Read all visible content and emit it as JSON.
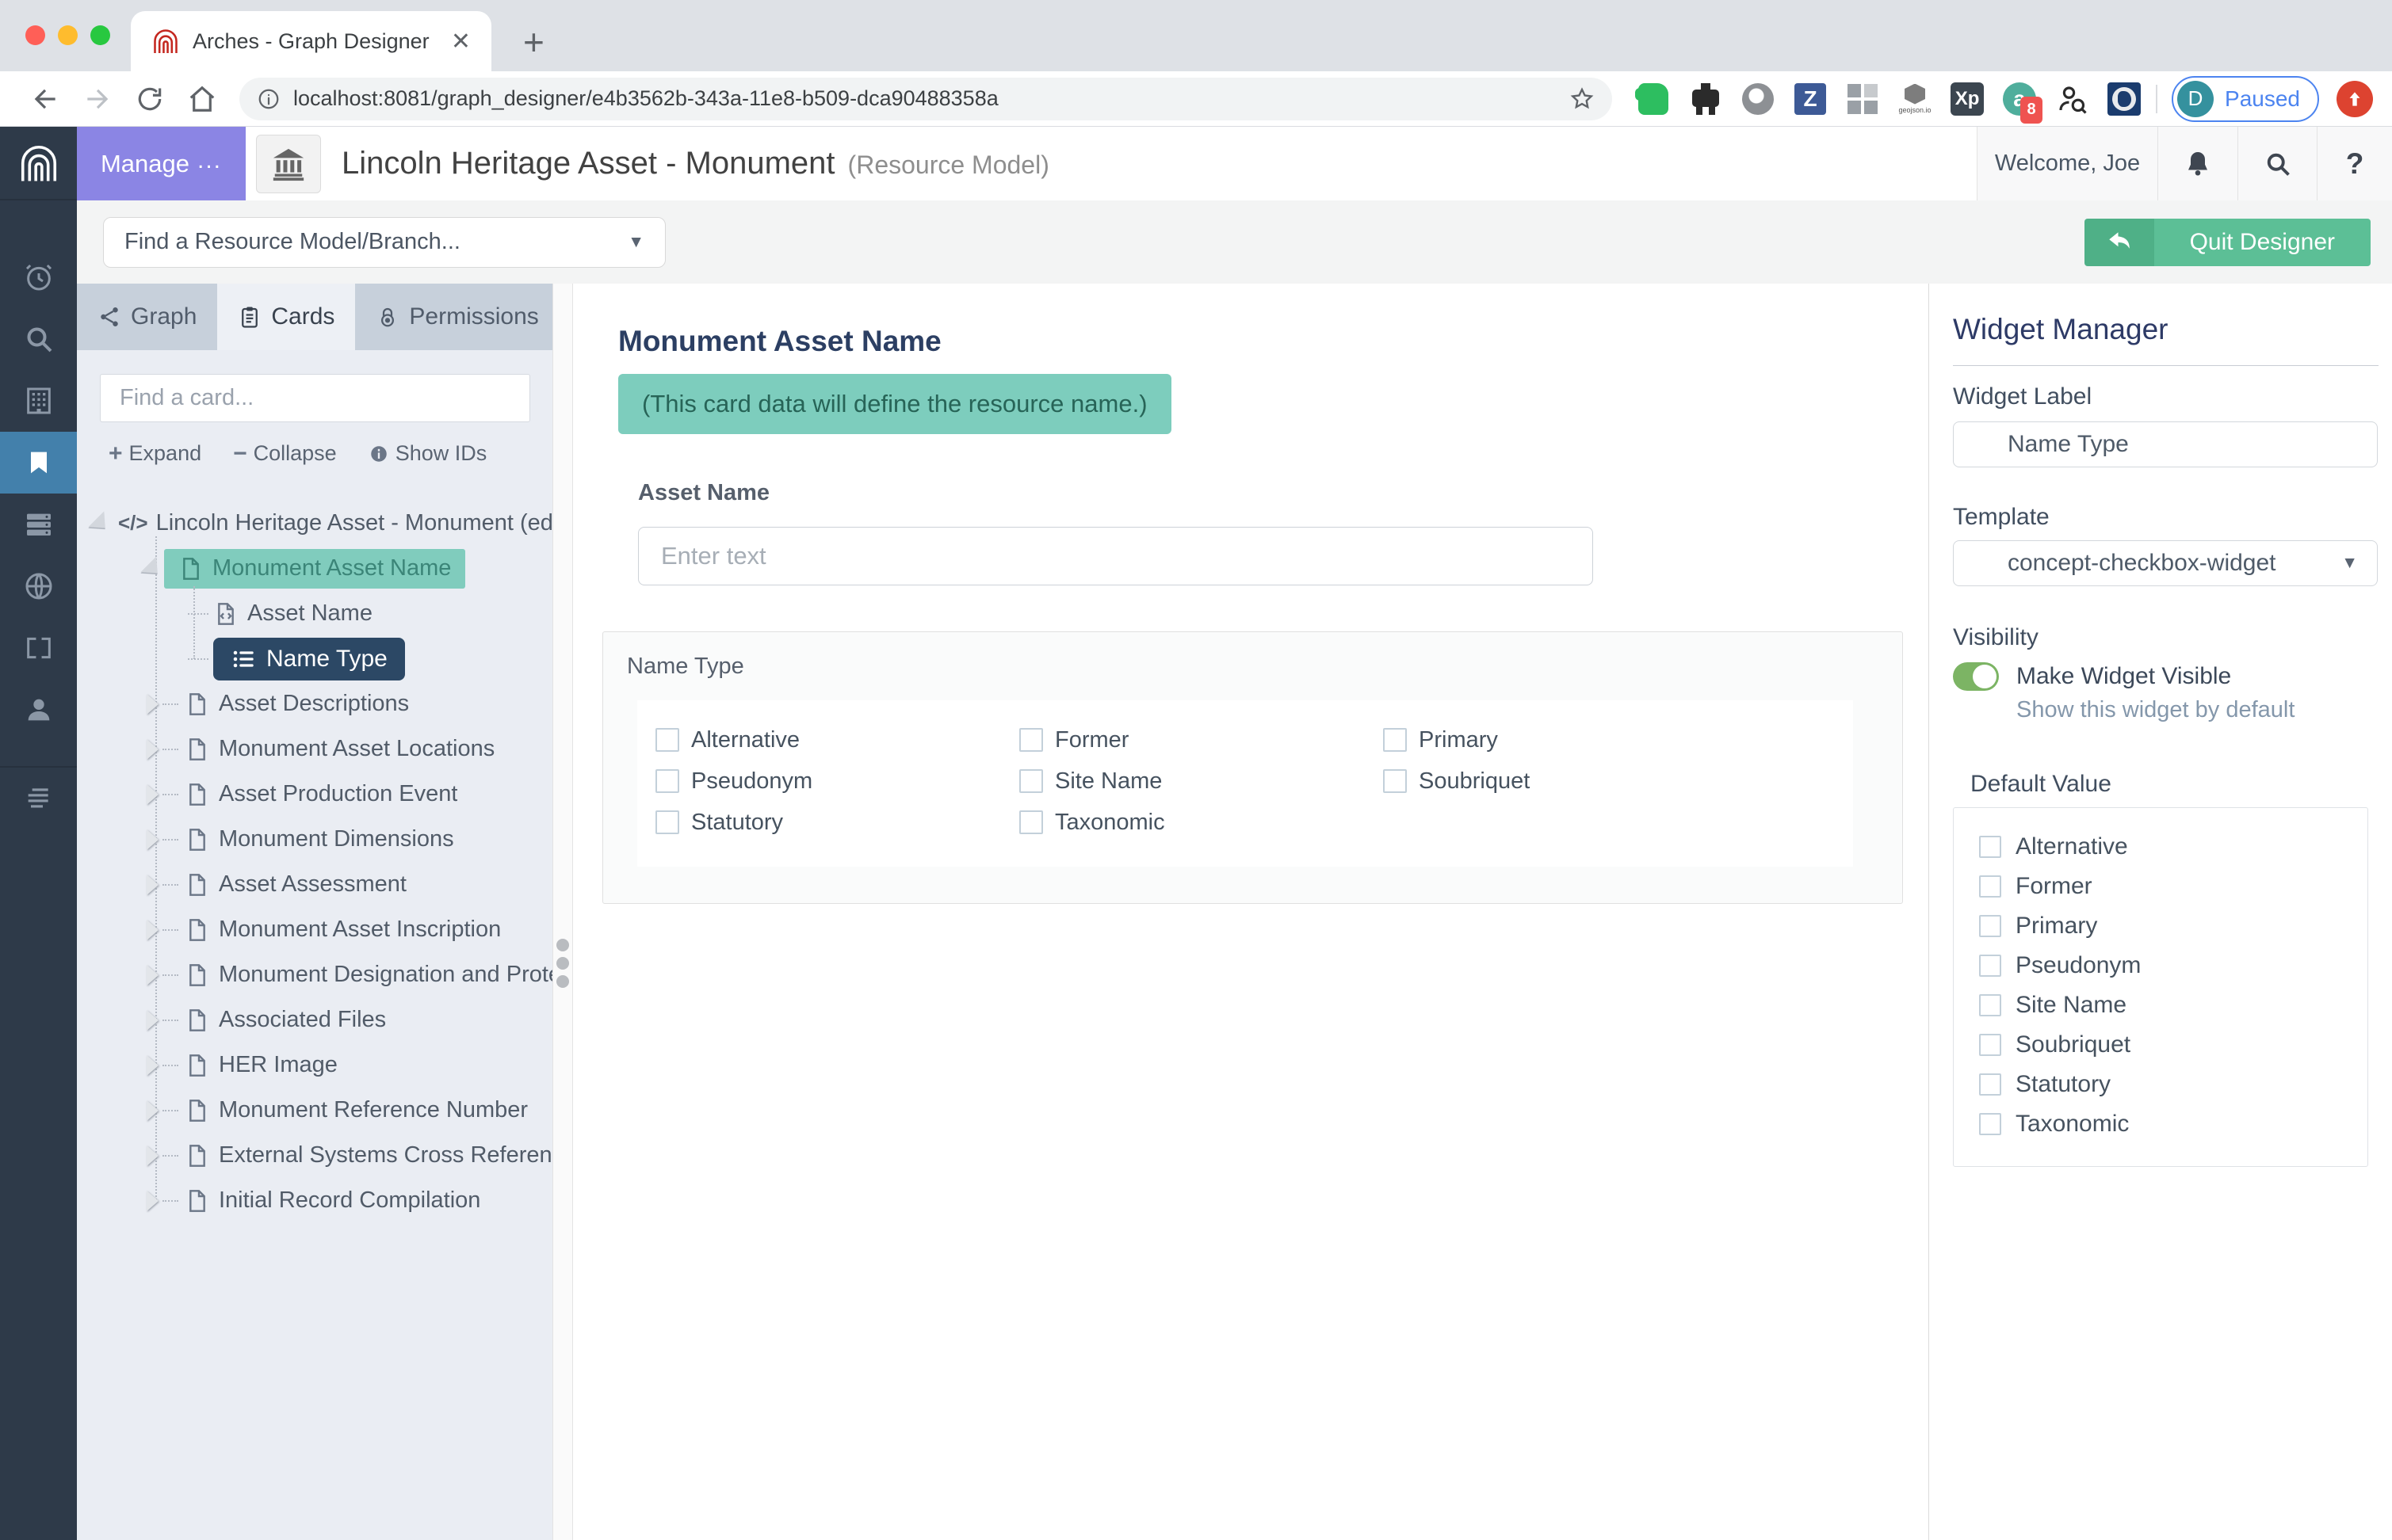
{
  "browser": {
    "tab_title": "Arches - Graph Designer",
    "url": "localhost:8081/graph_designer/e4b3562b-343a-11e8-b509-dca90488358a",
    "profile": {
      "initial": "D",
      "status": "Paused"
    },
    "extensions": {
      "zotero_glyph": "Z",
      "xp_glyph": "Xp",
      "a_glyph": "a",
      "a_badge_count": "8",
      "geojson_label": "geojson.io"
    }
  },
  "header": {
    "manage_label": "Manage",
    "manage_more_glyph": "...",
    "title": "Lincoln Heritage Asset - Monument",
    "subtitle": "(Resource Model)",
    "welcome": "Welcome, Joe",
    "help_glyph": "?"
  },
  "resource_bar": {
    "finder_placeholder": "Find a Resource Model/Branch...",
    "quit_label": "Quit Designer"
  },
  "tree_panel": {
    "tabs": [
      "Graph",
      "Cards",
      "Permissions"
    ],
    "search_placeholder": "Find a card...",
    "expand_label": "Expand",
    "collapse_label": "Collapse",
    "show_ids_label": "Show IDs",
    "root_glyph": "</>",
    "items": [
      "Lincoln Heritage Asset - Monument (edit r",
      "Monument Asset Name",
      "Asset Name",
      "Name Type",
      "Asset Descriptions",
      "Monument Asset Locations",
      "Asset Production Event",
      "Monument Dimensions",
      "Asset Assessment",
      "Monument Asset Inscription",
      "Monument Designation and Protectio",
      "Associated Files",
      "HER Image",
      "Monument Reference Number",
      "External Systems Cross Reference",
      "Initial Record Compilation"
    ]
  },
  "card_editor": {
    "title": "Monument Asset Name",
    "notice": "(This card data will define the resource name.)",
    "asset_name_label": "Asset Name",
    "asset_name_placeholder": "Enter text",
    "name_type_label": "Name Type",
    "options": [
      "Alternative",
      "Former",
      "Primary",
      "Pseudonym",
      "Site Name",
      "Soubriquet",
      "Statutory",
      "Taxonomic"
    ]
  },
  "widget_manager": {
    "title": "Widget Manager",
    "widget_label": "Widget Label",
    "widget_label_value": "Name Type",
    "template_label": "Template",
    "template_value": "concept-checkbox-widget",
    "visibility_label": "Visibility",
    "visible_label": "Make Widget Visible",
    "visible_hint": "Show this widget by default",
    "default_value_label": "Default Value",
    "default_options": [
      "Alternative",
      "Former",
      "Primary",
      "Pseudonym",
      "Site Name",
      "Soubriquet",
      "Statutory",
      "Taxonomic"
    ]
  },
  "colors": {
    "accent_purple": "#8b85e4",
    "accent_teal": "#7fccbd",
    "accent_navy": "#2c4865",
    "accent_green": "#5abc95",
    "sidebar_active_blue": "#4380ab",
    "toggle_green": "#7cb464"
  }
}
